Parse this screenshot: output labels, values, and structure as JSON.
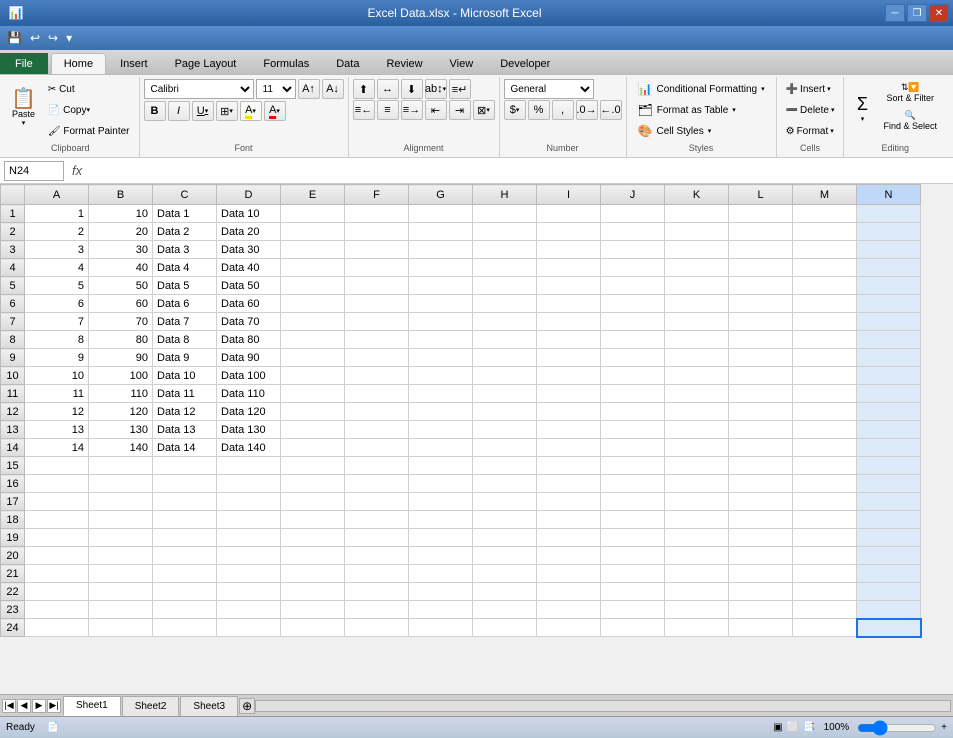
{
  "titlebar": {
    "title": "Excel Data.xlsx - Microsoft Excel",
    "icon": "📊"
  },
  "win_controls": {
    "minimize": "─",
    "restore": "❐",
    "close": "✕"
  },
  "tabs": [
    {
      "label": "File",
      "type": "file"
    },
    {
      "label": "Home",
      "active": true
    },
    {
      "label": "Insert"
    },
    {
      "label": "Page Layout"
    },
    {
      "label": "Formulas"
    },
    {
      "label": "Data"
    },
    {
      "label": "Review"
    },
    {
      "label": "View"
    },
    {
      "label": "Developer"
    }
  ],
  "quick_access": {
    "save": "💾",
    "undo": "↩",
    "redo": "↪",
    "dropdown": "▾"
  },
  "ribbon": {
    "groups": {
      "clipboard": {
        "label": "Clipboard",
        "paste_label": "Paste"
      },
      "font": {
        "label": "Font",
        "font_name": "Calibri",
        "font_size": "11",
        "bold": "B",
        "italic": "I",
        "underline": "U"
      },
      "alignment": {
        "label": "Alignment"
      },
      "number": {
        "label": "Number",
        "format": "General"
      },
      "styles": {
        "label": "Styles",
        "conditional": "Conditional Formatting",
        "format_table": "Format as Table",
        "cell_styles": "Cell Styles"
      },
      "cells": {
        "label": "Cells",
        "insert": "Insert",
        "delete": "Delete",
        "format": "Format"
      },
      "editing": {
        "label": "Editing",
        "sort_filter": "Sort & Filter",
        "find_select": "Find & Select"
      }
    }
  },
  "formula_bar": {
    "cell_ref": "N24",
    "fx": "fx"
  },
  "grid": {
    "columns": [
      "",
      "A",
      "B",
      "C",
      "D",
      "E",
      "F",
      "G",
      "H",
      "I",
      "J",
      "K",
      "L",
      "M",
      "N"
    ],
    "active_col": "N",
    "active_row": 24,
    "rows": [
      {
        "row": 1,
        "A": 1,
        "B": 10,
        "C": "Data 1",
        "D": "Data 10"
      },
      {
        "row": 2,
        "A": 2,
        "B": 20,
        "C": "Data 2",
        "D": "Data 20"
      },
      {
        "row": 3,
        "A": 3,
        "B": 30,
        "C": "Data 3",
        "D": "Data 30"
      },
      {
        "row": 4,
        "A": 4,
        "B": 40,
        "C": "Data 4",
        "D": "Data 40"
      },
      {
        "row": 5,
        "A": 5,
        "B": 50,
        "C": "Data 5",
        "D": "Data 50"
      },
      {
        "row": 6,
        "A": 6,
        "B": 60,
        "C": "Data 6",
        "D": "Data 60"
      },
      {
        "row": 7,
        "A": 7,
        "B": 70,
        "C": "Data 7",
        "D": "Data 70"
      },
      {
        "row": 8,
        "A": 8,
        "B": 80,
        "C": "Data 8",
        "D": "Data 80"
      },
      {
        "row": 9,
        "A": 9,
        "B": 90,
        "C": "Data 9",
        "D": "Data 90"
      },
      {
        "row": 10,
        "A": 10,
        "B": 100,
        "C": "Data 10",
        "D": "Data 100"
      },
      {
        "row": 11,
        "A": 11,
        "B": 110,
        "C": "Data 11",
        "D": "Data 110"
      },
      {
        "row": 12,
        "A": 12,
        "B": 120,
        "C": "Data 12",
        "D": "Data 120"
      },
      {
        "row": 13,
        "A": 13,
        "B": 130,
        "C": "Data 13",
        "D": "Data 130"
      },
      {
        "row": 14,
        "A": 14,
        "B": 140,
        "C": "Data 14",
        "D": "Data 140"
      },
      {
        "row": 15
      },
      {
        "row": 16
      },
      {
        "row": 17
      },
      {
        "row": 18
      },
      {
        "row": 19
      },
      {
        "row": 20
      },
      {
        "row": 21
      },
      {
        "row": 22
      },
      {
        "row": 23
      },
      {
        "row": 24
      }
    ]
  },
  "sheet_tabs": [
    "Sheet1",
    "Sheet2",
    "Sheet3"
  ],
  "active_sheet": "Sheet1",
  "status": {
    "ready": "Ready",
    "zoom": "100%"
  }
}
